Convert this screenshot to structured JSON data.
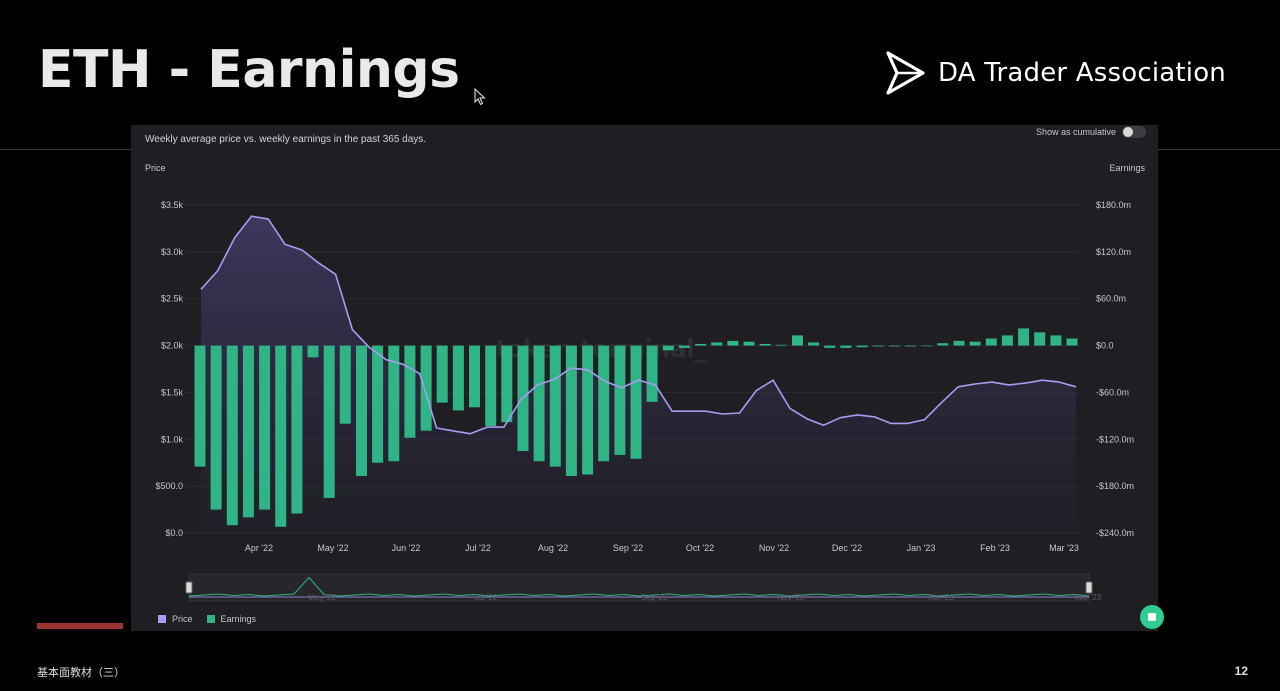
{
  "slide": {
    "title": "ETH - Earnings",
    "brand": "DA Trader Association",
    "footer_text": "基本面教材（三）",
    "page_number": "12"
  },
  "panel": {
    "subtitle": "Weekly average price vs. weekly earnings in the past 365 days.",
    "toggle_label": "Show as cumulative",
    "toggle_on": false,
    "watermark": "token terminal_"
  },
  "colors": {
    "price": "#a89cf0",
    "earnings": "#2fb486",
    "panel_bg": "#1f1f23",
    "accent_red": "#9c3434"
  },
  "chart_data": {
    "type": "bar",
    "title": "",
    "y_left_label": "Price",
    "y_right_label": "Earnings",
    "y_left_ticks": [
      "$3.5k",
      "$3.0k",
      "$2.5k",
      "$2.0k",
      "$1.5k",
      "$1.0k",
      "$500.0",
      "$0.0"
    ],
    "y_right_ticks": [
      "$180.0m",
      "$120.0m",
      "$60.0m",
      "$0.0",
      "-$60.0m",
      "-$120.0m",
      "-$180.0m",
      "-$240.0m"
    ],
    "y_left_range": [
      0,
      3500
    ],
    "y_right_range": [
      -240,
      180
    ],
    "x_ticks": [
      "Apr '22",
      "May '22",
      "Jun '22",
      "Jul '22",
      "Aug '22",
      "Sep '22",
      "Oct '22",
      "Nov '22",
      "Dec '22",
      "Jan '23",
      "Feb '23",
      "Mar '23"
    ],
    "navigator_ticks": [
      "May '22",
      "Jul '22",
      "Sep '22",
      "Nov '22",
      "Jan '23",
      "Mar '23"
    ],
    "grid": true,
    "legend_position": "bottom-left",
    "series": [
      {
        "name": "Price",
        "kind": "area-line",
        "axis": "left",
        "values": [
          2600,
          2800,
          3150,
          3380,
          3350,
          3080,
          3020,
          2880,
          2760,
          2170,
          1980,
          1850,
          1800,
          1700,
          1120,
          1090,
          1060,
          1130,
          1130,
          1420,
          1580,
          1640,
          1760,
          1740,
          1620,
          1550,
          1630,
          1580,
          1300,
          1300,
          1300,
          1270,
          1280,
          1520,
          1630,
          1330,
          1220,
          1150,
          1230,
          1260,
          1240,
          1170,
          1170,
          1210,
          1390,
          1560,
          1590,
          1610,
          1580,
          1600,
          1630,
          1610,
          1560
        ]
      },
      {
        "name": "Earnings",
        "kind": "bar",
        "axis": "right",
        "values": [
          -155,
          -210,
          -230,
          -220,
          -210,
          -232,
          -215,
          -15,
          -195,
          -100,
          -167,
          -150,
          -148,
          -118,
          -109,
          -73,
          -83,
          -79,
          -103,
          -98,
          -135,
          -148,
          -155,
          -167,
          -165,
          -148,
          -140,
          -145,
          -72,
          -6,
          -3,
          2,
          4,
          6,
          5,
          2,
          1,
          13,
          4,
          -3,
          -3,
          -2,
          -1,
          -1,
          -1,
          0,
          3,
          6,
          5,
          9,
          13,
          22,
          17,
          13,
          9
        ]
      }
    ]
  }
}
